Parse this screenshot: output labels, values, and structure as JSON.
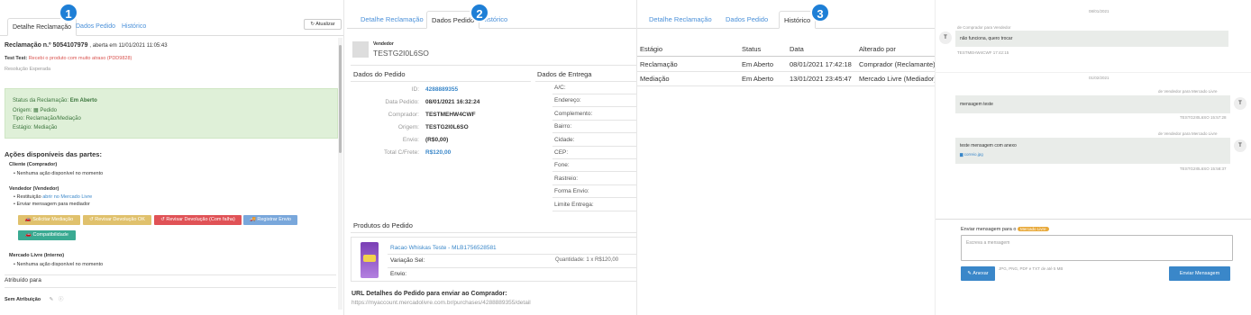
{
  "badges": {
    "b1": "1",
    "b2": "2",
    "b3": "3"
  },
  "panel1": {
    "tabs": {
      "detalhe": "Detalhe Reclamação",
      "dados": "Dados Pedido",
      "historico": "Histórico"
    },
    "atualizar": "Atualizar",
    "title_prefix": "Reclamação n.º 5054107979",
    "title_suffix": ", aberta em 11/01/2021 11:05:43",
    "test_label": "Test Test:",
    "test_text": "Recebi o produto com muito atraso (PDD9828)",
    "resolucao": "Resolução Esperada",
    "status": {
      "label": "Status da Reclamação:",
      "value": "Em Aberto",
      "origem": "Origem: ▦ Pedido",
      "tipo": "Tipo: Reclamação/Mediação",
      "estagio": "Estágio: Mediação"
    },
    "acoes_title": "Ações disponíveis das partes:",
    "cliente_title": "Cliente (Comprador)",
    "cliente_item": "Nenhuma ação disponível no momento",
    "vendedor_title": "Vendedor (Vendedor)",
    "vend_item1_prefix": "Restituição",
    "vend_item1_link": "abrir no Mercado Livre",
    "vend_item2": "Enviar mensagem para mediador",
    "buttons": {
      "solicitar": "Solicitar Mediação",
      "revisar_ok": "Revisar Devolução OK",
      "revisar_falha": "Revisar Devolução (Com falha)",
      "registrar": "Registrar Envio",
      "compat": "Compatibilidade"
    },
    "ml_title": "Mercado Livre (Interno)",
    "ml_item": "Nenhuma ação disponível no momento",
    "atribuido": "Atribuído para",
    "sem_atrib": "Sem Atribuição"
  },
  "panel2": {
    "tabs": {
      "detalhe": "Detalhe Reclamação",
      "dados": "Dados Pedido",
      "historico": "Histórico"
    },
    "vendedor_label": "Vendedor",
    "vendedor_name": "TESTG2I0L6SO",
    "dados_pedido": "Dados do Pedido",
    "dados_entrega": "Dados de Entrega",
    "rows": [
      {
        "k": "ID:",
        "v": "4288889355"
      },
      {
        "k": "Data Pedido:",
        "v": "08/01/2021 16:32:24"
      },
      {
        "k": "Comprador:",
        "v": "TESTMEHW4CWF"
      },
      {
        "k": "Origem:",
        "v": "TESTG2I0L6SO"
      },
      {
        "k": "Envio:",
        "v": "(R$0,00)"
      },
      {
        "k": "Total C/Frete:",
        "v": "R$120,00"
      }
    ],
    "entrega": [
      "A/C:",
      "Endereço:",
      "Complemento:",
      "Bairro:",
      "Cidade:",
      "CEP:",
      "Fone:",
      "Rastreio:",
      "Forma Envio:",
      "Limite Entrega:"
    ],
    "produtos_title": "Produtos do Pedido",
    "produto_link": "Racao Whiskas Teste - MLB1756528581",
    "variacao": "Variação Sel:",
    "quantidade": "Quantidade: 1 x R$120,00",
    "envio": "Envio:",
    "url_title": "URL Detalhes do Pedido para enviar ao Comprador:",
    "url": "https://myaccount.mercadolivre.com.br/purchases/4288889355/detail"
  },
  "panel3": {
    "tabs": {
      "detalhe": "Detalhe Reclamação",
      "dados": "Dados Pedido",
      "historico": "Histórico"
    },
    "headers": {
      "estagio": "Estágio",
      "status": "Status",
      "data": "Data",
      "alterado": "Alterado por"
    },
    "rows": [
      {
        "estagio": "Reclamação",
        "status": "Em Aberto",
        "data": "08/01/2021 17:42:18",
        "alterado": "Comprador (Reclamante)"
      },
      {
        "estagio": "Mediação",
        "status": "Em Aberto",
        "data": "13/01/2021 23:45:47",
        "alterado": "Mercado Livre (Mediador)"
      }
    ]
  },
  "panel4": {
    "date1": "08/01/2021",
    "msg1": {
      "avatar": "T",
      "from": "de Comprador para Vendedor",
      "text": "não funciona, quero trocar",
      "meta": "TESTMEHW4CWF 17:42:15"
    },
    "date2": "01/02/2021",
    "msg2": {
      "avatar": "T",
      "from": "de Vendedor para Mercado Livre",
      "text": "mensagem teste",
      "meta": "TESTG2I0L6SO 15:57:28"
    },
    "msg3": {
      "avatar": "T",
      "from": "de Vendedor para Mercado Livre",
      "text": "teste mensagem com anexo",
      "attach": "correio.jpg",
      "meta": "TESTG2I0L6SO 15:58:37"
    },
    "send_label": "Enviar mensagem para o",
    "send_target": "Mercado Livre",
    "placeholder": "Escreva a mensagem",
    "anexar": "Anexar",
    "hint": "JPG, PNG, PDF e TXT de até 5 MB",
    "enviar": "Enviar Mensagem"
  }
}
